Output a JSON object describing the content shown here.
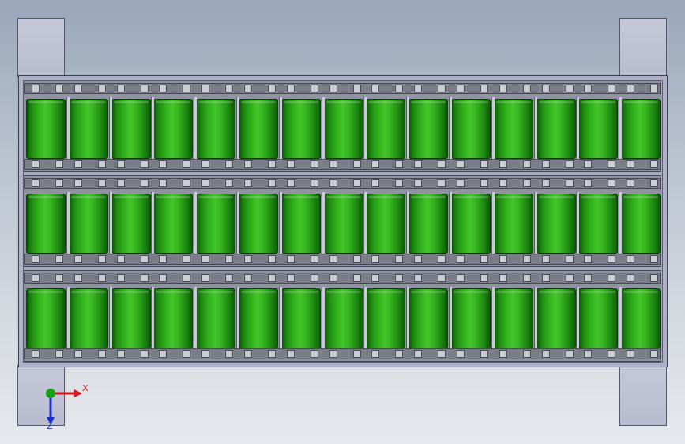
{
  "scene": {
    "background_top": "#9aa7ba",
    "background_bottom": "#e6e9ed",
    "cell_color": "#2fb01a",
    "frame_color": "#aeb1c6"
  },
  "battery_pack": {
    "modules": 3,
    "cells_per_module": 15
  },
  "triad": {
    "x_label": "X",
    "z_label": "Z",
    "x_color": "#d21c1c",
    "y_color": "#18a018",
    "z_color": "#1c2ed2"
  }
}
